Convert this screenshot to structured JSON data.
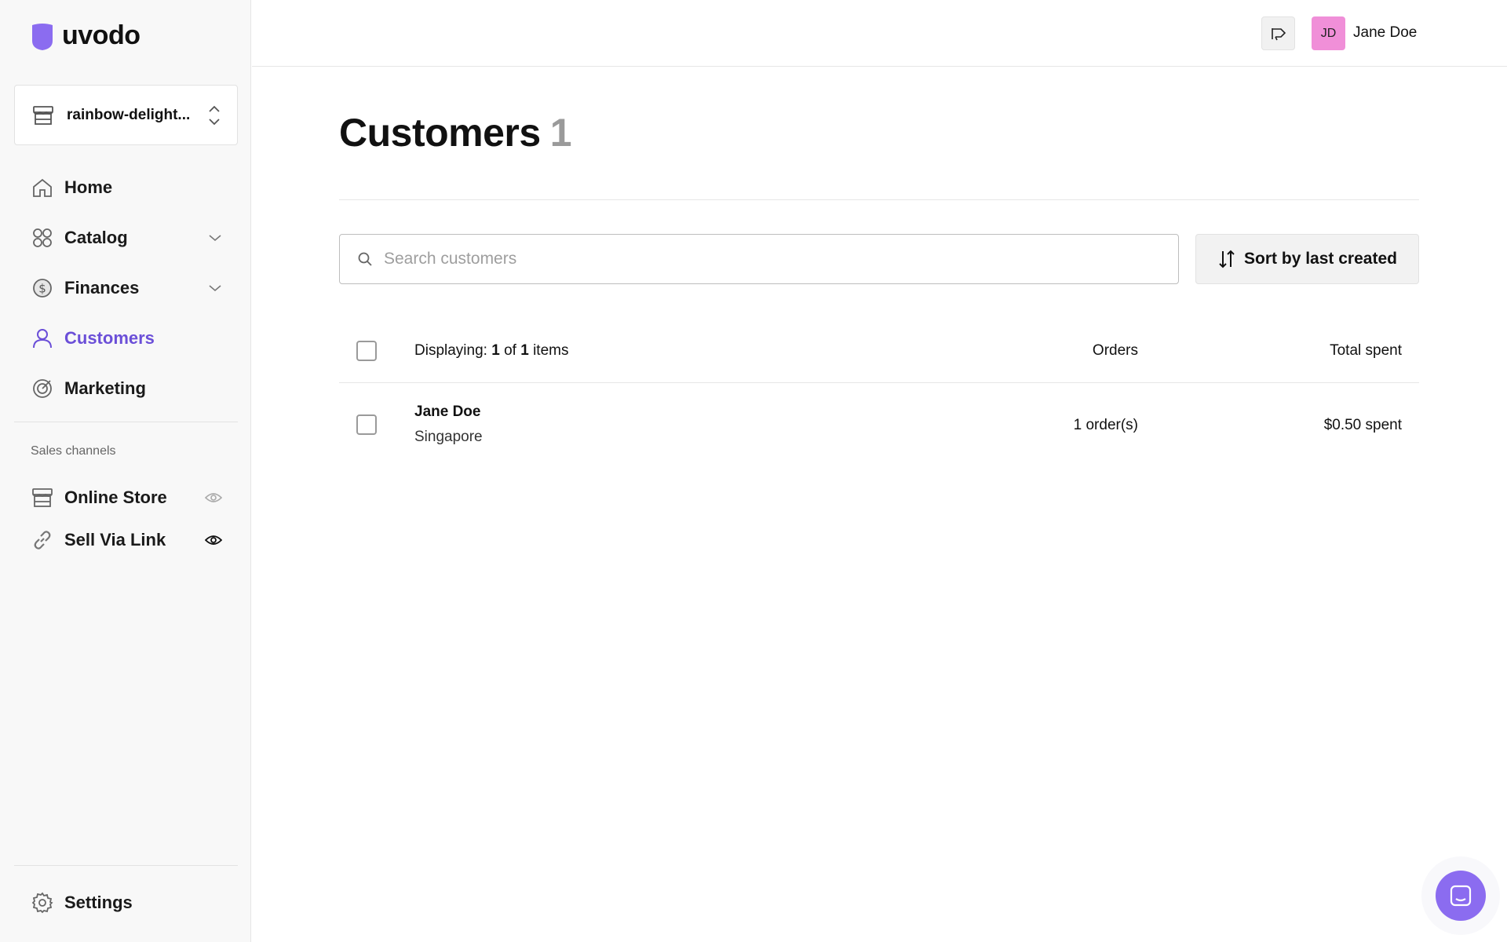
{
  "brand": {
    "name": "uvodo",
    "accent": "#6b4fd8",
    "logo_color": "#8b6cf0"
  },
  "store_switcher": {
    "name": "rainbow-delight..."
  },
  "nav": {
    "items": [
      {
        "label": "Home",
        "icon": "home-icon"
      },
      {
        "label": "Catalog",
        "icon": "catalog-icon",
        "expandable": true
      },
      {
        "label": "Finances",
        "icon": "dollar-icon",
        "expandable": true
      },
      {
        "label": "Customers",
        "icon": "user-icon",
        "active": true
      },
      {
        "label": "Marketing",
        "icon": "target-icon"
      }
    ]
  },
  "sales_channels": {
    "label": "Sales channels",
    "items": [
      {
        "label": "Online Store",
        "icon": "store-icon",
        "visibility": "hidden"
      },
      {
        "label": "Sell Via Link",
        "icon": "link-icon",
        "visibility": "visible"
      }
    ]
  },
  "settings": {
    "label": "Settings",
    "icon": "gear-icon"
  },
  "topbar": {
    "announce_icon": "megaphone-icon",
    "avatar_initials": "JD",
    "avatar_color": "#f08fd8",
    "user_name": "Jane Doe"
  },
  "page": {
    "title": "Customers",
    "count": "1"
  },
  "search": {
    "placeholder": "Search customers",
    "value": ""
  },
  "sort": {
    "label": "Sort by last created"
  },
  "table": {
    "displaying_prefix": "Displaying:",
    "displaying_shown": "1",
    "displaying_of": "of",
    "displaying_total": "1",
    "displaying_suffix": "items",
    "col_orders": "Orders",
    "col_total": "Total spent",
    "rows": [
      {
        "name": "Jane Doe",
        "location": "Singapore",
        "orders": "1 order(s)",
        "total": "$0.50 spent"
      }
    ]
  }
}
